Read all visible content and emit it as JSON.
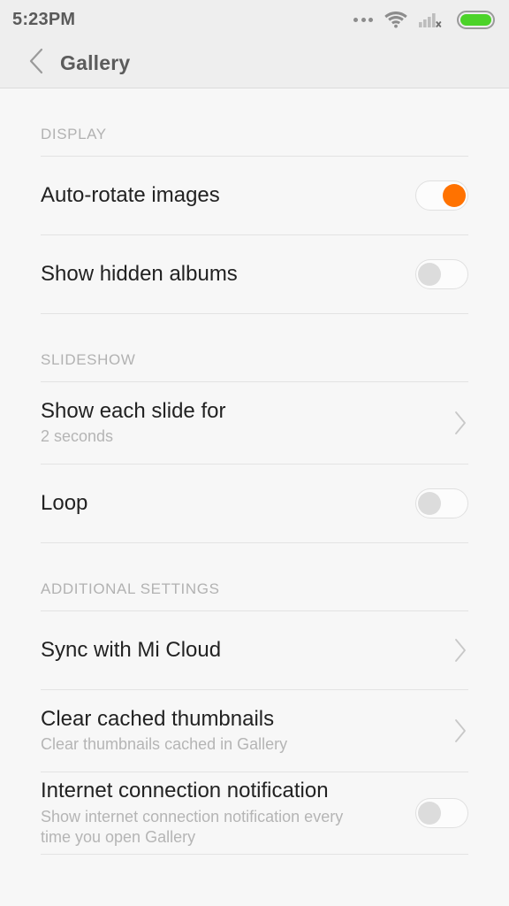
{
  "statusbar": {
    "time": "5:23PM",
    "icons": [
      "more-dots-icon",
      "wifi-icon",
      "signal-no-sim-icon",
      "battery-icon"
    ],
    "battery_color": "#4cd329"
  },
  "appbar": {
    "back_icon": "chevron-left-icon",
    "title": "Gallery"
  },
  "accent_color": "#ff7200",
  "sections": [
    {
      "header": "DISPLAY",
      "rows": [
        {
          "title": "Auto-rotate images",
          "sub": "",
          "control": "toggle",
          "state": "on"
        },
        {
          "title": "Show hidden albums",
          "sub": "",
          "control": "toggle",
          "state": "off"
        }
      ]
    },
    {
      "header": "SLIDESHOW",
      "rows": [
        {
          "title": "Show each slide for",
          "sub": "2  seconds",
          "control": "chevron",
          "state": ""
        },
        {
          "title": "Loop",
          "sub": "",
          "control": "toggle",
          "state": "off"
        }
      ]
    },
    {
      "header": "ADDITIONAL SETTINGS",
      "rows": [
        {
          "title": "Sync with Mi Cloud",
          "sub": "",
          "control": "chevron",
          "state": ""
        },
        {
          "title": "Clear cached thumbnails",
          "sub": "Clear thumbnails cached in Gallery",
          "control": "chevron",
          "state": ""
        },
        {
          "title": "Internet connection notification",
          "sub": "Show internet connection notification every\ntime you open Gallery",
          "control": "toggle",
          "state": "off"
        }
      ]
    }
  ]
}
